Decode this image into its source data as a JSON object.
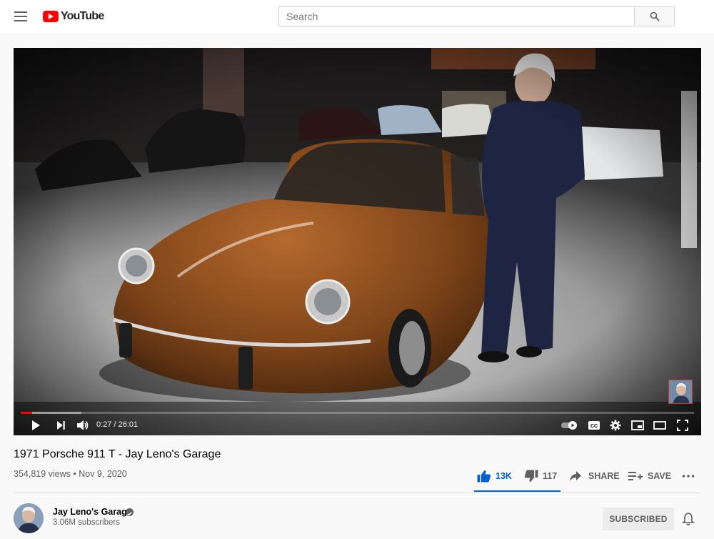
{
  "header": {
    "logo_text": "YouTube",
    "search_placeholder": "Search"
  },
  "player": {
    "current_time": "0:27",
    "duration": "26:01",
    "time_display": "0:27 / 26:01",
    "progress_fraction": 0.017,
    "buffer_fraction": 0.09
  },
  "video": {
    "title": "1971 Porsche 911 T - Jay Leno's Garage",
    "meta": "354,819 views • Nov 9, 2020"
  },
  "actions": {
    "likes": "13K",
    "dislikes": "117",
    "share_label": "SHARE",
    "save_label": "SAVE"
  },
  "channel": {
    "name": "Jay Leno's Garage",
    "subscribers": "3.06M subscribers",
    "subscribe_label": "SUBSCRIBED"
  },
  "colors": {
    "brand_red": "#ff0000",
    "like_blue": "#065fd4",
    "car_brown": "#8a4a1c"
  }
}
